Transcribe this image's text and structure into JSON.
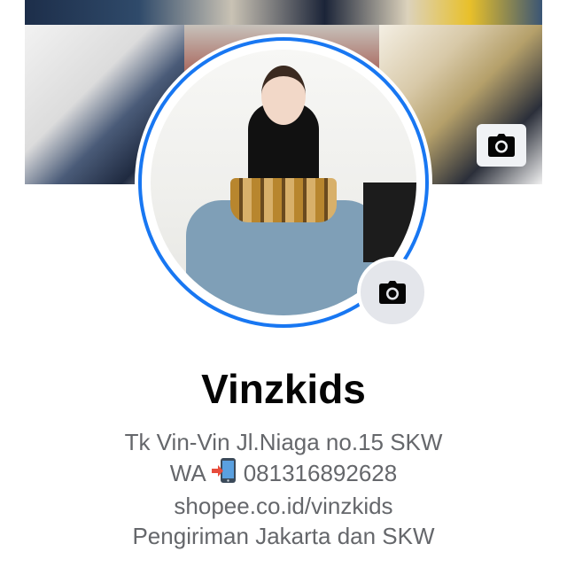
{
  "profile": {
    "name": "Vinzkids",
    "bio_lines": [
      "Tk Vin-Vin Jl.Niaga no.15 SKW",
      {
        "prefix": "WA",
        "icon": "mobile-phone-arrow-icon",
        "number": "081316892628"
      },
      "shopee.co.id/vinzkids",
      "Pengiriman Jakarta dan SKW"
    ]
  },
  "icons": {
    "cover_camera": "camera-icon",
    "avatar_camera": "camera-icon"
  },
  "colors": {
    "ring": "#1877f2",
    "name": "#050505",
    "bio": "#65676b",
    "camera_button_bg": "#e4e6eb"
  }
}
